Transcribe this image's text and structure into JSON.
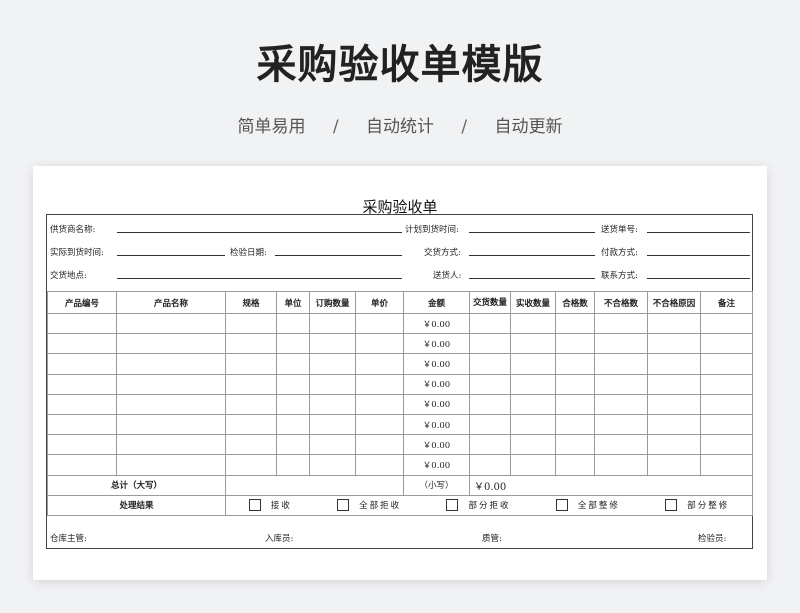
{
  "banner": {
    "title": "采购验收单模版",
    "features": [
      "简单易用",
      "自动统计",
      "自动更新"
    ],
    "separator": "/"
  },
  "form": {
    "title": "采购验收单",
    "info": {
      "supplier_name": "供货商名称:",
      "planned_arrival": "计划到货时间:",
      "delivery_no": "送货单号:",
      "actual_arrival": "实际到货时间:",
      "inspection_date": "检验日期:",
      "delivery_method": "交货方式:",
      "payment_method": "付款方式:",
      "delivery_place": "交货地点:",
      "deliverer": "送货人:",
      "contact_method": "联系方式:"
    },
    "columns": [
      "产品编号",
      "产品名称",
      "规格",
      "单位",
      "订购数量",
      "单价",
      "金额",
      "交货数量",
      "实收数量",
      "合格数",
      "不合格数",
      "不合格原因",
      "备注"
    ],
    "rows": [
      {
        "amount": "￥0.00"
      },
      {
        "amount": "￥0.00"
      },
      {
        "amount": "￥0.00"
      },
      {
        "amount": "￥0.00"
      },
      {
        "amount": "￥0.00"
      },
      {
        "amount": "￥0.00"
      },
      {
        "amount": "￥0.00"
      },
      {
        "amount": "￥0.00"
      }
    ],
    "total": {
      "label": "总计（大写）",
      "small_label": "（小写）",
      "small_value": "￥0.00"
    },
    "processing": {
      "label": "处理结果",
      "options": [
        "接收",
        "全部拒收",
        "部分拒收",
        "全部整修",
        "部分整修"
      ]
    },
    "footer": {
      "warehouse_manager": "仓库主管:",
      "stock_keeper": "入库员:",
      "quality": "质管:",
      "inspector": "检验员:"
    }
  }
}
